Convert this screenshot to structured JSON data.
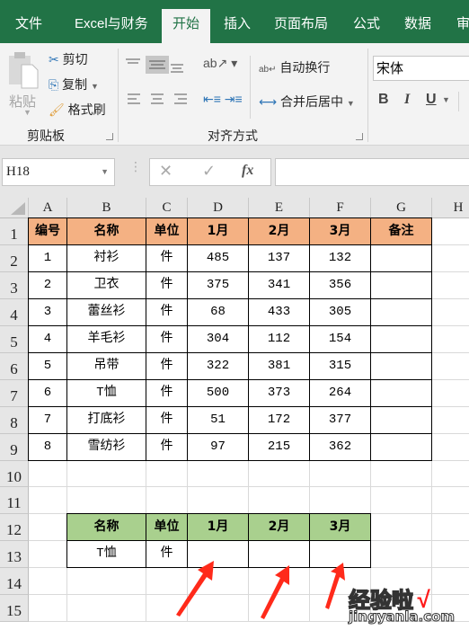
{
  "ribbon_tabs": [
    "文件",
    "Excel与财务",
    "开始",
    "插入",
    "页面布局",
    "公式",
    "数据",
    "审"
  ],
  "active_tab": "开始",
  "clipboard": {
    "paste": "粘贴",
    "cut": "剪切",
    "copy": "复制",
    "format_painter": "格式刷",
    "group": "剪贴板"
  },
  "alignment": {
    "wrap_text": "自动换行",
    "merge_center": "合并后居中",
    "group": "对齐方式"
  },
  "font": {
    "name": "宋体",
    "bold": "B",
    "italic": "I",
    "underline": "U"
  },
  "name_box": "H18",
  "formula_bar": {
    "cancel": "✕",
    "enter": "✓",
    "fx": "fx",
    "value": ""
  },
  "columns": [
    "A",
    "B",
    "C",
    "D",
    "E",
    "F",
    "G",
    "H"
  ],
  "rows": [
    "1",
    "2",
    "3",
    "4",
    "5",
    "6",
    "7",
    "8",
    "9",
    "10",
    "11",
    "12",
    "13",
    "14",
    "15"
  ],
  "table1": {
    "headers": [
      "编号",
      "名称",
      "单位",
      "1月",
      "2月",
      "3月",
      "备注"
    ],
    "rows": [
      [
        "1",
        "衬衫",
        "件",
        "485",
        "137",
        "132",
        ""
      ],
      [
        "2",
        "卫衣",
        "件",
        "375",
        "341",
        "356",
        ""
      ],
      [
        "3",
        "蕾丝衫",
        "件",
        "68",
        "433",
        "305",
        ""
      ],
      [
        "4",
        "羊毛衫",
        "件",
        "304",
        "112",
        "154",
        ""
      ],
      [
        "5",
        "吊带",
        "件",
        "322",
        "381",
        "315",
        ""
      ],
      [
        "6",
        "T恤",
        "件",
        "500",
        "373",
        "264",
        ""
      ],
      [
        "7",
        "打底衫",
        "件",
        "51",
        "172",
        "377",
        ""
      ],
      [
        "8",
        "雪纺衫",
        "件",
        "97",
        "215",
        "362",
        ""
      ]
    ],
    "header_color": "#f4b183"
  },
  "table2": {
    "headers": [
      "名称",
      "单位",
      "1月",
      "2月",
      "3月"
    ],
    "rows": [
      [
        "T恤",
        "件",
        "",
        "",
        ""
      ]
    ],
    "header_color": "#a9d08e"
  },
  "watermark": {
    "text": "经验啦",
    "check": "√",
    "url": "jingyanla.com"
  }
}
